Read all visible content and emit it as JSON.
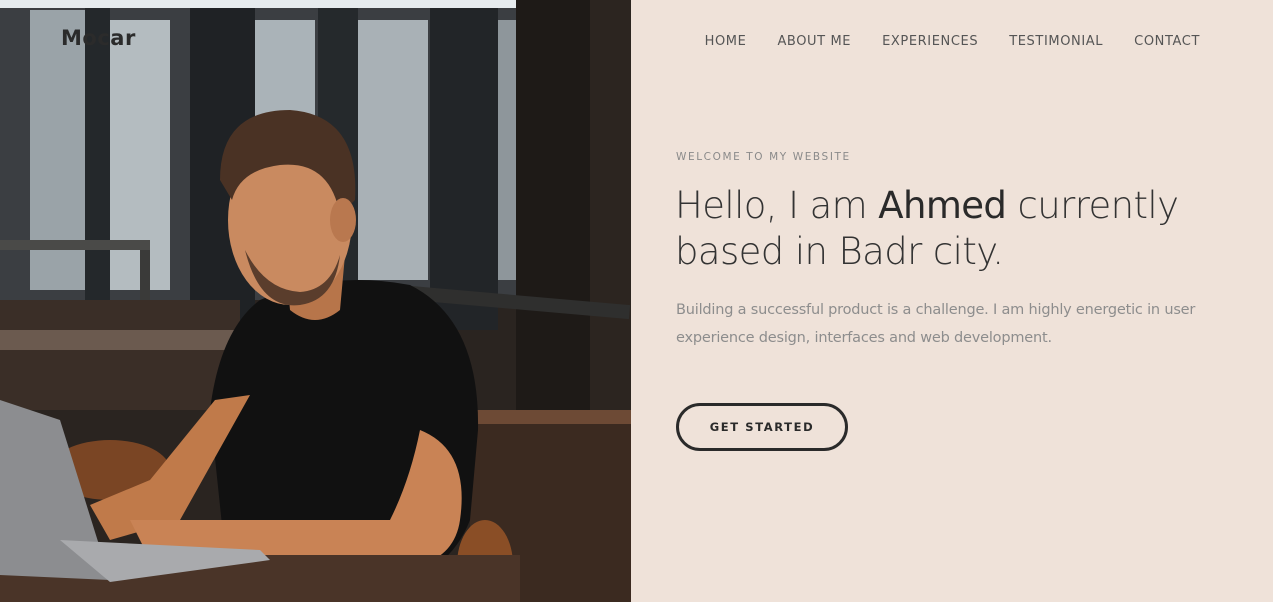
{
  "brand": {
    "logo": "Mocar"
  },
  "nav": {
    "items": [
      "HOME",
      "ABOUT ME",
      "EXPERIENCES",
      "TESTIMONIAL",
      "CONTACT"
    ]
  },
  "hero": {
    "eyebrow": "WELCOME TO MY WEBSITE",
    "title_pre": "Hello, I am ",
    "title_name": "Ahmed",
    "title_post": " currently based in Badr city.",
    "description": "Building a successful product is a challenge. I am highly energetic in user experience design, interfaces and web development.",
    "cta_label": "GET STARTED"
  },
  "colors": {
    "background": "#efe2d9",
    "text": "#333333",
    "muted": "#8d8d8d",
    "button_border": "#2a2a2a"
  },
  "image": {
    "semantic": "man-working-on-laptop-photo"
  }
}
